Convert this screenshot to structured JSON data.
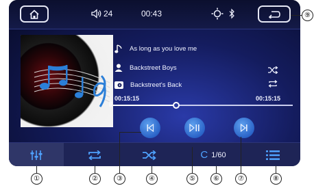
{
  "status_bar": {
    "volume": "24",
    "time": "00:43"
  },
  "track": {
    "title": "As long as you love me",
    "artist": "Backstreet Boys",
    "album": "Backstreet's Back",
    "elapsed": "00:15:15",
    "total": "00:15:15",
    "progress": 0.35
  },
  "playlist": {
    "counter": "1/60"
  },
  "callouts": [
    "①",
    "②",
    "③",
    "④",
    "⑤",
    "⑥",
    "⑦",
    "⑧",
    "⑨"
  ],
  "colors": {
    "accent": "#4fa2ff",
    "background": "#141c5e",
    "bar": "#1e2456"
  },
  "icons": {
    "home": "home-icon",
    "volume": "speaker-icon",
    "brightness": "sun-icon",
    "bluetooth": "bluetooth-icon",
    "back": "back-arrow-icon",
    "prev": "previous-track-icon",
    "play": "play-pause-icon",
    "next": "next-track-icon",
    "eq": "equalizer-icon",
    "repeat": "repeat-icon",
    "shuffle": "shuffle-icon",
    "list": "list-icon"
  }
}
